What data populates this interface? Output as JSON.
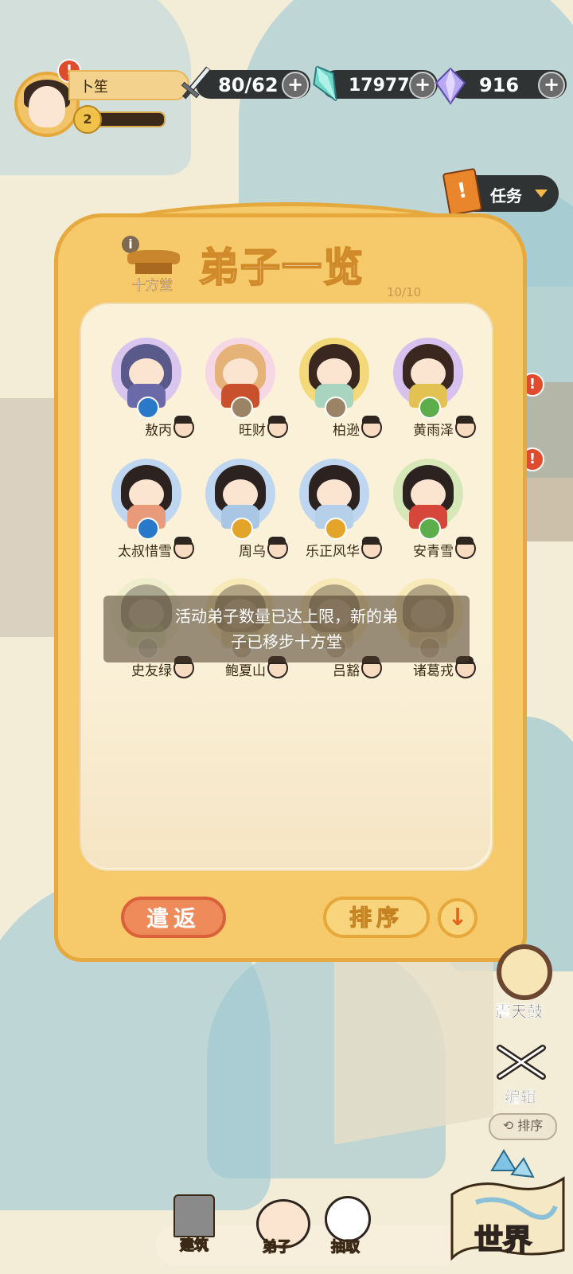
{
  "player": {
    "name": "卜笙",
    "level": "2",
    "alert": "!"
  },
  "resources": [
    {
      "icon": "sword-icon",
      "value": "80/62",
      "plus": "+"
    },
    {
      "icon": "crystal-icon",
      "value": "179777",
      "plus": "+"
    },
    {
      "icon": "gem-icon",
      "value": "916",
      "plus": "+"
    }
  ],
  "task": {
    "label": "任务"
  },
  "panel": {
    "title": "弟子一览",
    "hall_label": "十方堂",
    "count": "10/10",
    "info": "i",
    "disciples": [
      {
        "name": "敖丙",
        "ring": "#d9c6ef",
        "element": "#2a78c8",
        "hair": "#5a5a8a",
        "body": "#6a6aa8"
      },
      {
        "name": "旺财",
        "ring": "#f6d8e4",
        "element": "#9b8466",
        "hair": "#e5b278",
        "body": "#c9502d"
      },
      {
        "name": "柏逊",
        "ring": "#f3d97a",
        "element": "#9b8466",
        "hair": "#3a2820",
        "body": "#a8d4c0"
      },
      {
        "name": "黄雨泽",
        "ring": "#d6c1ef",
        "element": "#5cae4a",
        "hair": "#3a2820",
        "body": "#e2c253"
      },
      {
        "name": "太叔惜雪",
        "ring": "#bfd6f0",
        "element": "#2a78c8",
        "hair": "#2c2220",
        "body": "#e89a7a"
      },
      {
        "name": "周乌",
        "ring": "#bfd6f0",
        "element": "#e2a52a",
        "hair": "#2c2220",
        "body": "#a9c7e4"
      },
      {
        "name": "乐正风华",
        "ring": "#bfd6f0",
        "element": "#e2a52a",
        "hair": "#2c2220",
        "body": "#b7d0ea"
      },
      {
        "name": "安青雪",
        "ring": "#d7e8b8",
        "element": "#5cae4a",
        "hair": "#2c2220",
        "body": "#d6463a"
      },
      {
        "name": "史友绿",
        "ring": "#d7e8b8",
        "element": "#9b9b9b",
        "hair": "#2c2220",
        "body": "#c8d0a0"
      },
      {
        "name": "鲍夏山",
        "ring": "#f3d97a",
        "element": "#9b8466",
        "hair": "#2c2220",
        "body": "#c8b890"
      },
      {
        "name": "吕豁",
        "ring": "#f3d97a",
        "element": "#9b8466",
        "hair": "#2c2220",
        "body": "#c8b890"
      },
      {
        "name": "诸葛戎",
        "ring": "#f3d97a",
        "element": "#9b8466",
        "hair": "#2c2220",
        "body": "#c8b890"
      }
    ],
    "toast_line1": "活动弟子数量已达上限，新的弟",
    "toast_line2": "子已移步十方堂",
    "dismiss_label": "遣返",
    "sort_label": "排序",
    "sort_dir": "↓"
  },
  "side": {
    "drum_label": "震天鼓",
    "edit_label": "编辑",
    "sort_small": "排序"
  },
  "nav": {
    "build": "建筑",
    "disciple": "弟子",
    "draw": "抽取",
    "world": "世界"
  }
}
